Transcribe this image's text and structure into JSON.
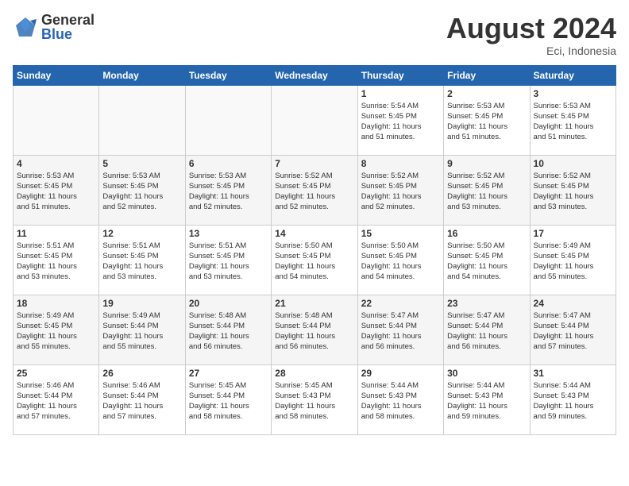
{
  "logo": {
    "general": "General",
    "blue": "Blue"
  },
  "title": {
    "month_year": "August 2024",
    "location": "Eci, Indonesia"
  },
  "days_header": [
    "Sunday",
    "Monday",
    "Tuesday",
    "Wednesday",
    "Thursday",
    "Friday",
    "Saturday"
  ],
  "weeks": [
    [
      {
        "day": "",
        "info": ""
      },
      {
        "day": "",
        "info": ""
      },
      {
        "day": "",
        "info": ""
      },
      {
        "day": "",
        "info": ""
      },
      {
        "day": "1",
        "info": "Sunrise: 5:54 AM\nSunset: 5:45 PM\nDaylight: 11 hours\nand 51 minutes."
      },
      {
        "day": "2",
        "info": "Sunrise: 5:53 AM\nSunset: 5:45 PM\nDaylight: 11 hours\nand 51 minutes."
      },
      {
        "day": "3",
        "info": "Sunrise: 5:53 AM\nSunset: 5:45 PM\nDaylight: 11 hours\nand 51 minutes."
      }
    ],
    [
      {
        "day": "4",
        "info": "Sunrise: 5:53 AM\nSunset: 5:45 PM\nDaylight: 11 hours\nand 51 minutes."
      },
      {
        "day": "5",
        "info": "Sunrise: 5:53 AM\nSunset: 5:45 PM\nDaylight: 11 hours\nand 52 minutes."
      },
      {
        "day": "6",
        "info": "Sunrise: 5:53 AM\nSunset: 5:45 PM\nDaylight: 11 hours\nand 52 minutes."
      },
      {
        "day": "7",
        "info": "Sunrise: 5:52 AM\nSunset: 5:45 PM\nDaylight: 11 hours\nand 52 minutes."
      },
      {
        "day": "8",
        "info": "Sunrise: 5:52 AM\nSunset: 5:45 PM\nDaylight: 11 hours\nand 52 minutes."
      },
      {
        "day": "9",
        "info": "Sunrise: 5:52 AM\nSunset: 5:45 PM\nDaylight: 11 hours\nand 53 minutes."
      },
      {
        "day": "10",
        "info": "Sunrise: 5:52 AM\nSunset: 5:45 PM\nDaylight: 11 hours\nand 53 minutes."
      }
    ],
    [
      {
        "day": "11",
        "info": "Sunrise: 5:51 AM\nSunset: 5:45 PM\nDaylight: 11 hours\nand 53 minutes."
      },
      {
        "day": "12",
        "info": "Sunrise: 5:51 AM\nSunset: 5:45 PM\nDaylight: 11 hours\nand 53 minutes."
      },
      {
        "day": "13",
        "info": "Sunrise: 5:51 AM\nSunset: 5:45 PM\nDaylight: 11 hours\nand 53 minutes."
      },
      {
        "day": "14",
        "info": "Sunrise: 5:50 AM\nSunset: 5:45 PM\nDaylight: 11 hours\nand 54 minutes."
      },
      {
        "day": "15",
        "info": "Sunrise: 5:50 AM\nSunset: 5:45 PM\nDaylight: 11 hours\nand 54 minutes."
      },
      {
        "day": "16",
        "info": "Sunrise: 5:50 AM\nSunset: 5:45 PM\nDaylight: 11 hours\nand 54 minutes."
      },
      {
        "day": "17",
        "info": "Sunrise: 5:49 AM\nSunset: 5:45 PM\nDaylight: 11 hours\nand 55 minutes."
      }
    ],
    [
      {
        "day": "18",
        "info": "Sunrise: 5:49 AM\nSunset: 5:45 PM\nDaylight: 11 hours\nand 55 minutes."
      },
      {
        "day": "19",
        "info": "Sunrise: 5:49 AM\nSunset: 5:44 PM\nDaylight: 11 hours\nand 55 minutes."
      },
      {
        "day": "20",
        "info": "Sunrise: 5:48 AM\nSunset: 5:44 PM\nDaylight: 11 hours\nand 56 minutes."
      },
      {
        "day": "21",
        "info": "Sunrise: 5:48 AM\nSunset: 5:44 PM\nDaylight: 11 hours\nand 56 minutes."
      },
      {
        "day": "22",
        "info": "Sunrise: 5:47 AM\nSunset: 5:44 PM\nDaylight: 11 hours\nand 56 minutes."
      },
      {
        "day": "23",
        "info": "Sunrise: 5:47 AM\nSunset: 5:44 PM\nDaylight: 11 hours\nand 56 minutes."
      },
      {
        "day": "24",
        "info": "Sunrise: 5:47 AM\nSunset: 5:44 PM\nDaylight: 11 hours\nand 57 minutes."
      }
    ],
    [
      {
        "day": "25",
        "info": "Sunrise: 5:46 AM\nSunset: 5:44 PM\nDaylight: 11 hours\nand 57 minutes."
      },
      {
        "day": "26",
        "info": "Sunrise: 5:46 AM\nSunset: 5:44 PM\nDaylight: 11 hours\nand 57 minutes."
      },
      {
        "day": "27",
        "info": "Sunrise: 5:45 AM\nSunset: 5:44 PM\nDaylight: 11 hours\nand 58 minutes."
      },
      {
        "day": "28",
        "info": "Sunrise: 5:45 AM\nSunset: 5:43 PM\nDaylight: 11 hours\nand 58 minutes."
      },
      {
        "day": "29",
        "info": "Sunrise: 5:44 AM\nSunset: 5:43 PM\nDaylight: 11 hours\nand 58 minutes."
      },
      {
        "day": "30",
        "info": "Sunrise: 5:44 AM\nSunset: 5:43 PM\nDaylight: 11 hours\nand 59 minutes."
      },
      {
        "day": "31",
        "info": "Sunrise: 5:44 AM\nSunset: 5:43 PM\nDaylight: 11 hours\nand 59 minutes."
      }
    ]
  ]
}
